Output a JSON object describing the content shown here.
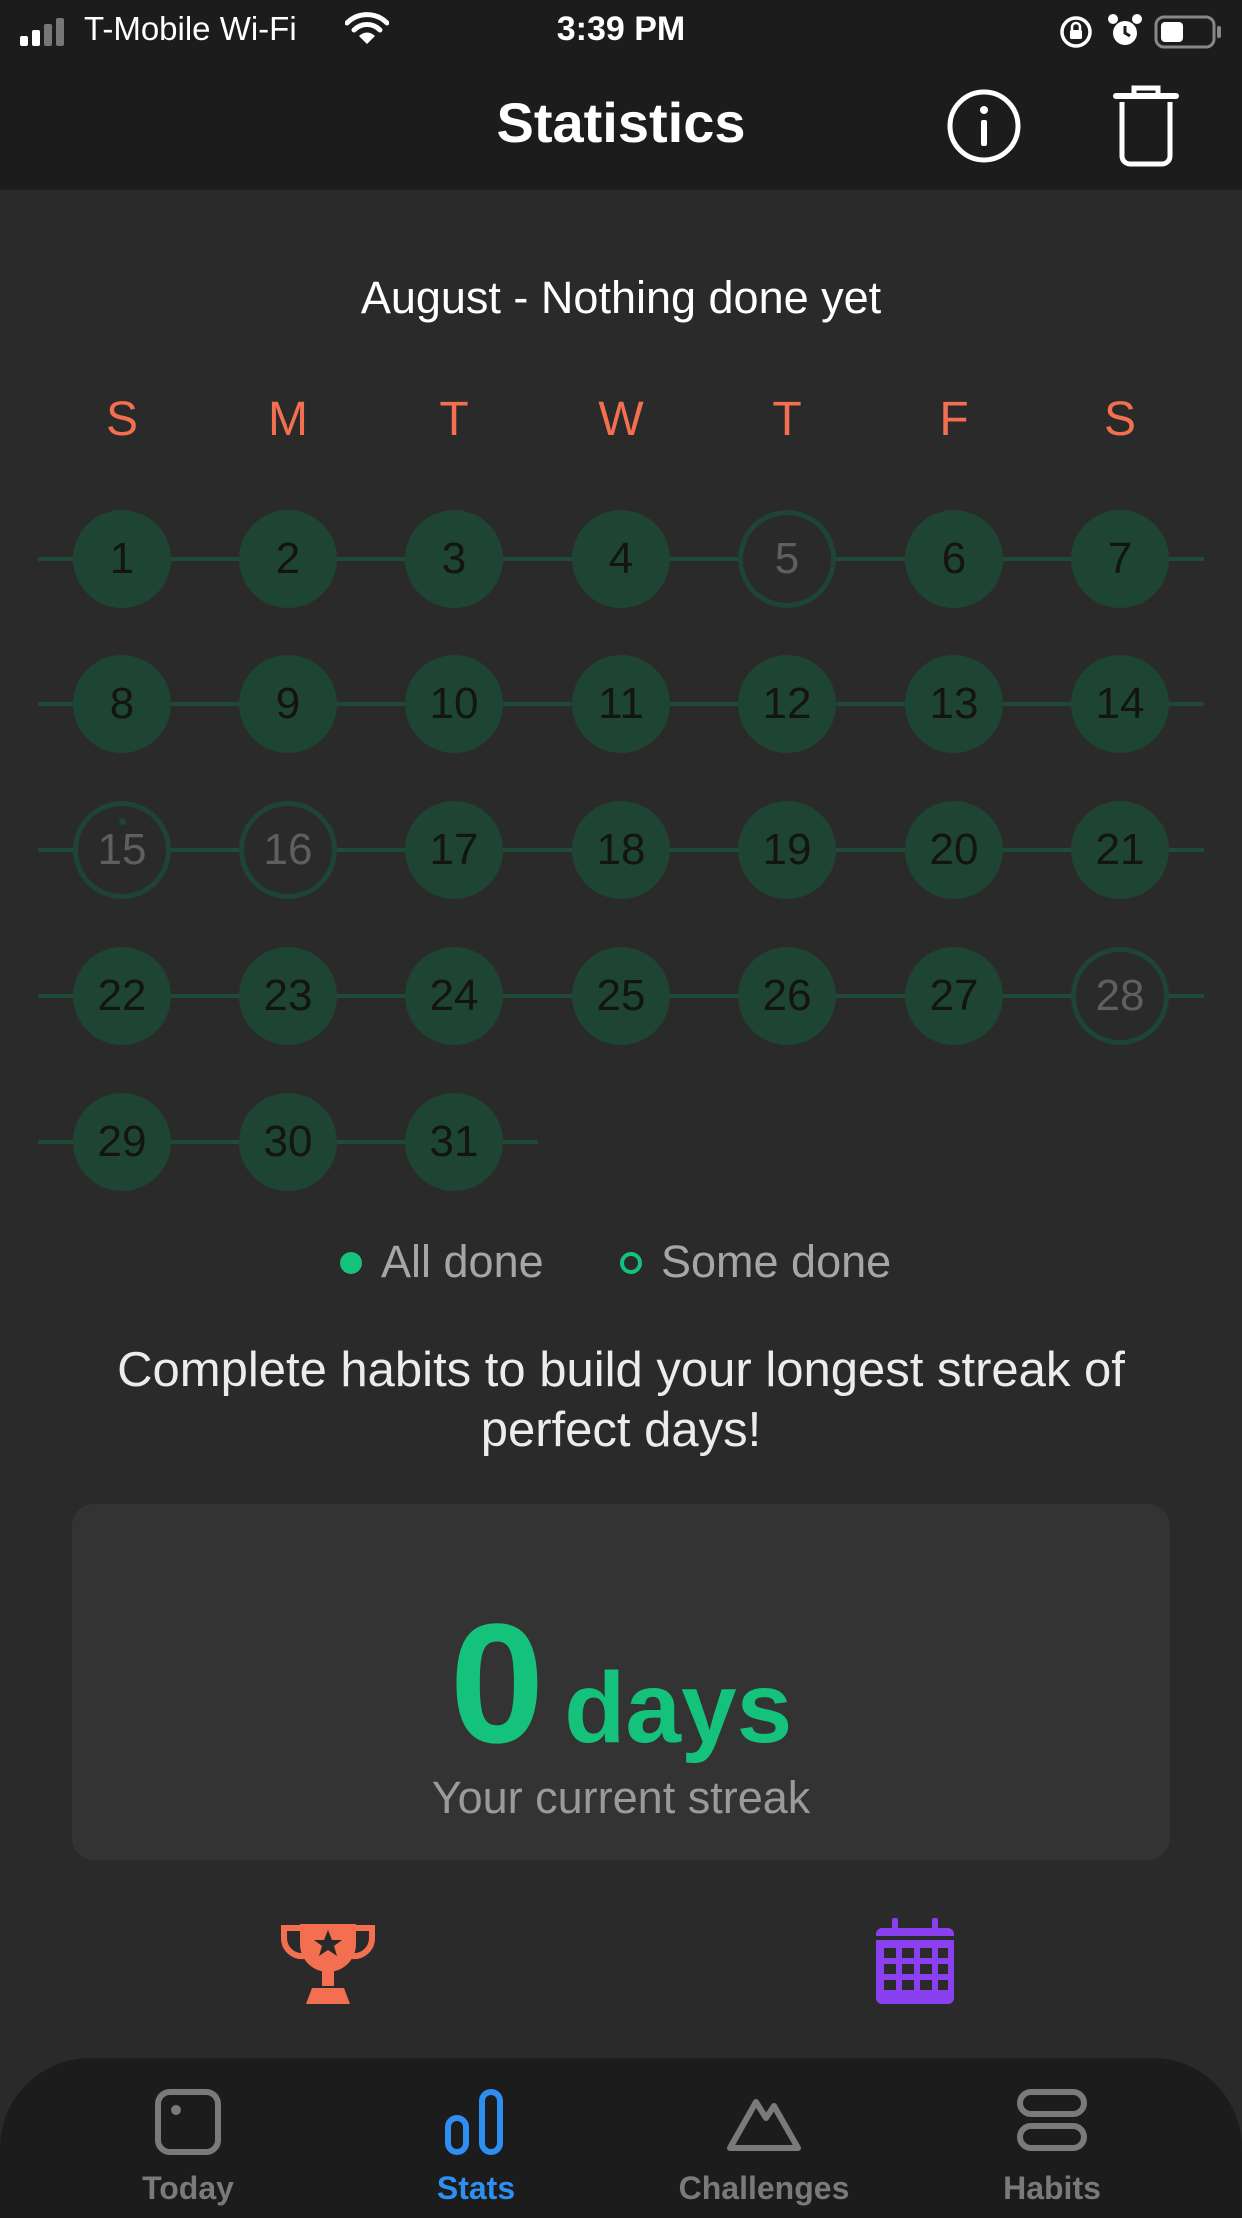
{
  "status_bar": {
    "carrier": "T-Mobile Wi-Fi",
    "time": "3:39 PM"
  },
  "header": {
    "title": "Statistics",
    "info_icon": "info-icon",
    "delete_icon": "trash-icon"
  },
  "calendar": {
    "month_title": "August - Nothing done yet",
    "weekdays": [
      "S",
      "M",
      "T",
      "W",
      "T",
      "F",
      "S"
    ],
    "days": [
      {
        "label": "1",
        "state": "filled"
      },
      {
        "label": "2",
        "state": "filled"
      },
      {
        "label": "3",
        "state": "filled"
      },
      {
        "label": "4",
        "state": "filled"
      },
      {
        "label": "5",
        "state": "ring"
      },
      {
        "label": "6",
        "state": "filled"
      },
      {
        "label": "7",
        "state": "filled"
      },
      {
        "label": "8",
        "state": "filled"
      },
      {
        "label": "9",
        "state": "filled"
      },
      {
        "label": "10",
        "state": "filled"
      },
      {
        "label": "11",
        "state": "filled"
      },
      {
        "label": "12",
        "state": "filled"
      },
      {
        "label": "13",
        "state": "filled"
      },
      {
        "label": "14",
        "state": "filled"
      },
      {
        "label": "15",
        "state": "ring",
        "today": true
      },
      {
        "label": "16",
        "state": "ring"
      },
      {
        "label": "17",
        "state": "filled"
      },
      {
        "label": "18",
        "state": "filled"
      },
      {
        "label": "19",
        "state": "filled"
      },
      {
        "label": "20",
        "state": "filled"
      },
      {
        "label": "21",
        "state": "filled"
      },
      {
        "label": "22",
        "state": "filled"
      },
      {
        "label": "23",
        "state": "filled"
      },
      {
        "label": "24",
        "state": "filled"
      },
      {
        "label": "25",
        "state": "filled"
      },
      {
        "label": "26",
        "state": "filled"
      },
      {
        "label": "27",
        "state": "filled"
      },
      {
        "label": "28",
        "state": "ring"
      },
      {
        "label": "29",
        "state": "filled"
      },
      {
        "label": "30",
        "state": "filled"
      },
      {
        "label": "31",
        "state": "filled"
      }
    ]
  },
  "legend": {
    "all_done": "All done",
    "some_done": "Some done"
  },
  "message": "Complete habits to build your longest streak of perfect days!",
  "streak": {
    "value": "0",
    "unit": "days",
    "label": "Your current streak"
  },
  "shortcuts": {
    "trophy_icon": "trophy-icon",
    "calendar_icon": "calendar-icon"
  },
  "tabs": [
    {
      "label": "Today",
      "icon": "today-icon",
      "active": false
    },
    {
      "label": "Stats",
      "icon": "stats-icon",
      "active": true
    },
    {
      "label": "Challenges",
      "icon": "challenges-icon",
      "active": false
    },
    {
      "label": "Habits",
      "icon": "habits-icon",
      "active": false
    }
  ],
  "colors": {
    "accent_green": "#15c27b",
    "weekday_orange": "#f46f4f",
    "trophy_orange": "#f46f4f",
    "calendar_purple": "#8a3ff0",
    "active_tab_blue": "#2e8ff0",
    "day_fill": "#1e4434"
  }
}
